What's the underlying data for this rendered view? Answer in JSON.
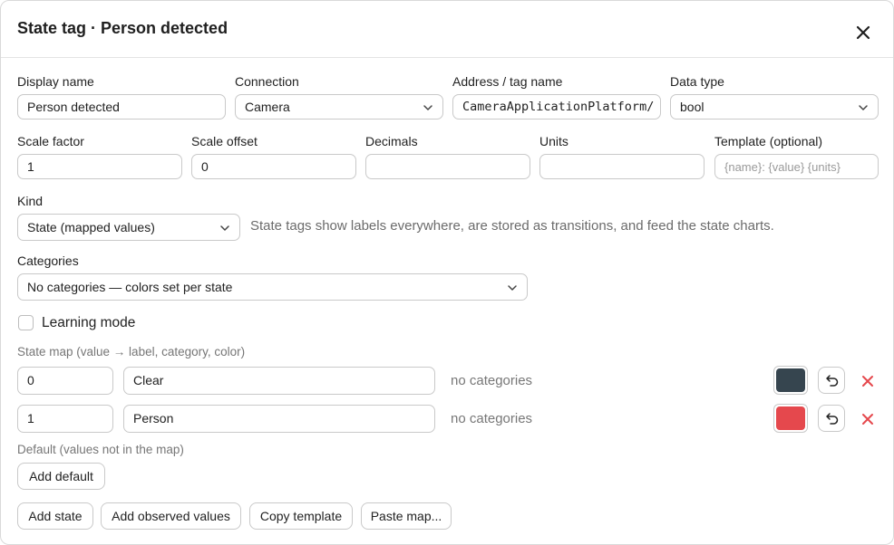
{
  "dialog": {
    "title": "State tag · Person detected"
  },
  "fields": {
    "display_name": {
      "label": "Display name",
      "value": "Person detected"
    },
    "connection": {
      "label": "Connection",
      "value": "Camera"
    },
    "address": {
      "label": "Address / tag name",
      "value": "CameraApplicationPlatform/"
    },
    "data_type": {
      "label": "Data type",
      "value": "bool"
    },
    "scale_factor": {
      "label": "Scale factor",
      "value": "1"
    },
    "scale_offset": {
      "label": "Scale offset",
      "value": "0"
    },
    "decimals": {
      "label": "Decimals",
      "value": ""
    },
    "units": {
      "label": "Units",
      "value": ""
    },
    "template": {
      "label": "Template (optional)",
      "value": "",
      "placeholder": "{name}: {value} {units}"
    },
    "kind": {
      "label": "Kind",
      "value": "State (mapped values)",
      "hint": "State tags show labels everywhere, are stored as transitions, and feed the state charts."
    },
    "categories": {
      "label": "Categories",
      "value": "No categories — colors set per state"
    }
  },
  "learning_mode": {
    "label": "Learning mode",
    "checked": false
  },
  "state_map": {
    "label": "State map (value → label, category, color)",
    "rows": [
      {
        "value": "0",
        "label": "Clear",
        "category": "no categories",
        "color": "#36454f"
      },
      {
        "value": "1",
        "label": "Person",
        "category": "no categories",
        "color": "#e5484d"
      }
    ]
  },
  "default_section": {
    "label": "Default (values not in the map)",
    "button": "Add default"
  },
  "footer": {
    "add_state": "Add state",
    "add_observed": "Add observed values",
    "copy_template": "Copy template",
    "paste_map": "Paste map..."
  },
  "icons": {
    "close": "close-icon",
    "chevron": "chevron-down-icon",
    "undo": "undo-icon",
    "delete": "delete-icon"
  },
  "colors": {
    "delete": "#e5484d",
    "border": "#c9c9c9"
  }
}
